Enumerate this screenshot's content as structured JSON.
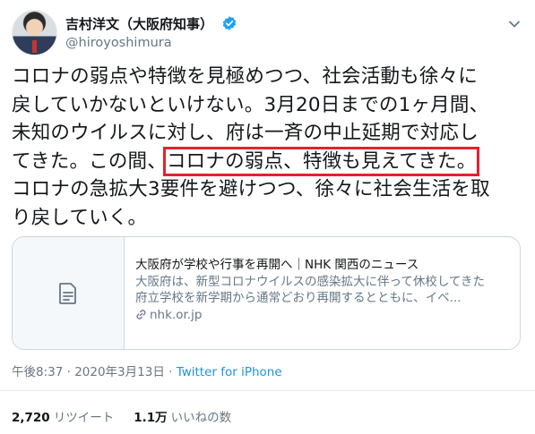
{
  "user": {
    "display_name": "吉村洋文（大阪府知事）",
    "handle": "@hiroyoshimura",
    "verified_icon": "verified-badge-icon",
    "accent_color": "#1da1f2"
  },
  "tweet": {
    "lines": [
      {
        "before": "コロナの弱点や特徴を見極めつつ、社会活動も徐々に"
      },
      {
        "before": "戻していかないといけない。3月20日までの1ヶ月間、"
      },
      {
        "before": "未知のウイルスに対し、府は一斉の中止延期で対応し"
      },
      {
        "before": "てきた。この間、",
        "highlight": "コロナの弱点、特徴も見えてきた。"
      },
      {
        "before": "コロナの急拡大3要件を避けつつ、徐々に社会生活を取"
      },
      {
        "before": "り戻していく。"
      }
    ],
    "highlight_color": "#e8202c"
  },
  "card": {
    "title": "大阪府が学校や行事を再開へ｜NHK 関西のニュース",
    "description_lines": [
      "大阪府は、新型コロナウイルスの感染拡大に伴って休校してきた",
      "府立学校を新学期から通常どおり再開するとともに、イベ..."
    ],
    "domain": "nhk.or.jp",
    "thumb_icon": "document-icon",
    "link_icon": "link-icon"
  },
  "meta": {
    "time": "午後8:37",
    "separator1": " · ",
    "date": "2020年3月13日",
    "separator2": " · ",
    "source": "Twitter for iPhone"
  },
  "stats": {
    "retweets_count": "2,720",
    "retweets_label": "リツイート",
    "likes_count": "1.1万",
    "likes_label": "いいねの数"
  }
}
